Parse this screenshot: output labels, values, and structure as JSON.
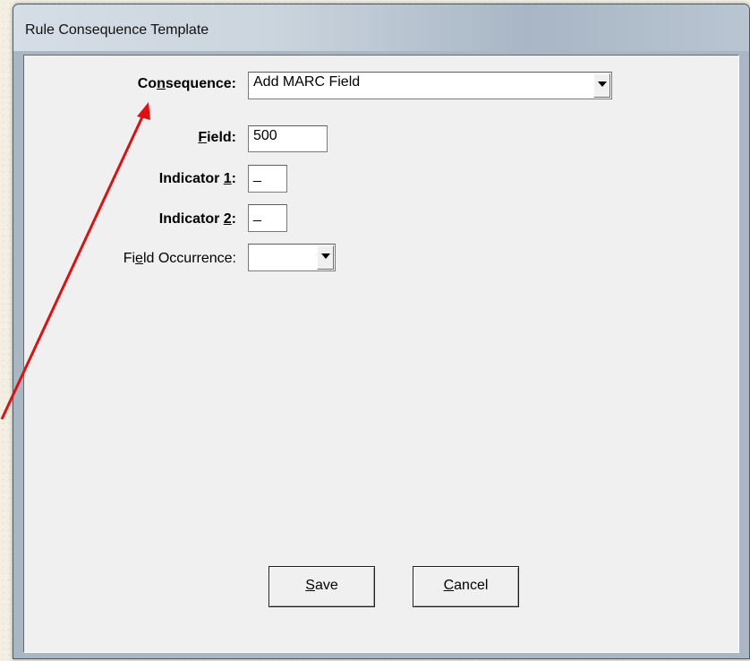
{
  "window": {
    "title": "Rule Consequence Template"
  },
  "form": {
    "consequence": {
      "label_pre": "Co",
      "label_ul": "n",
      "label_post": "sequence:",
      "value": "Add MARC Field"
    },
    "field": {
      "label_pre": "",
      "label_ul": "F",
      "label_post": "ield:",
      "value": "500"
    },
    "indicator1": {
      "label_pre": "Indicator ",
      "label_ul": "1",
      "label_post": ":",
      "value": "_"
    },
    "indicator2": {
      "label_pre": "Indicator ",
      "label_ul": "2",
      "label_post": ":",
      "value": "_"
    },
    "field_occurrence": {
      "label_pre": "Fi",
      "label_ul": "e",
      "label_post": "ld Occurrence:",
      "value": ""
    }
  },
  "buttons": {
    "save": {
      "label_ul": "S",
      "label_post": "ave"
    },
    "cancel": {
      "label_ul": "C",
      "label_post": "ancel"
    }
  },
  "annotation": {
    "arrow_color": "#e01010"
  }
}
